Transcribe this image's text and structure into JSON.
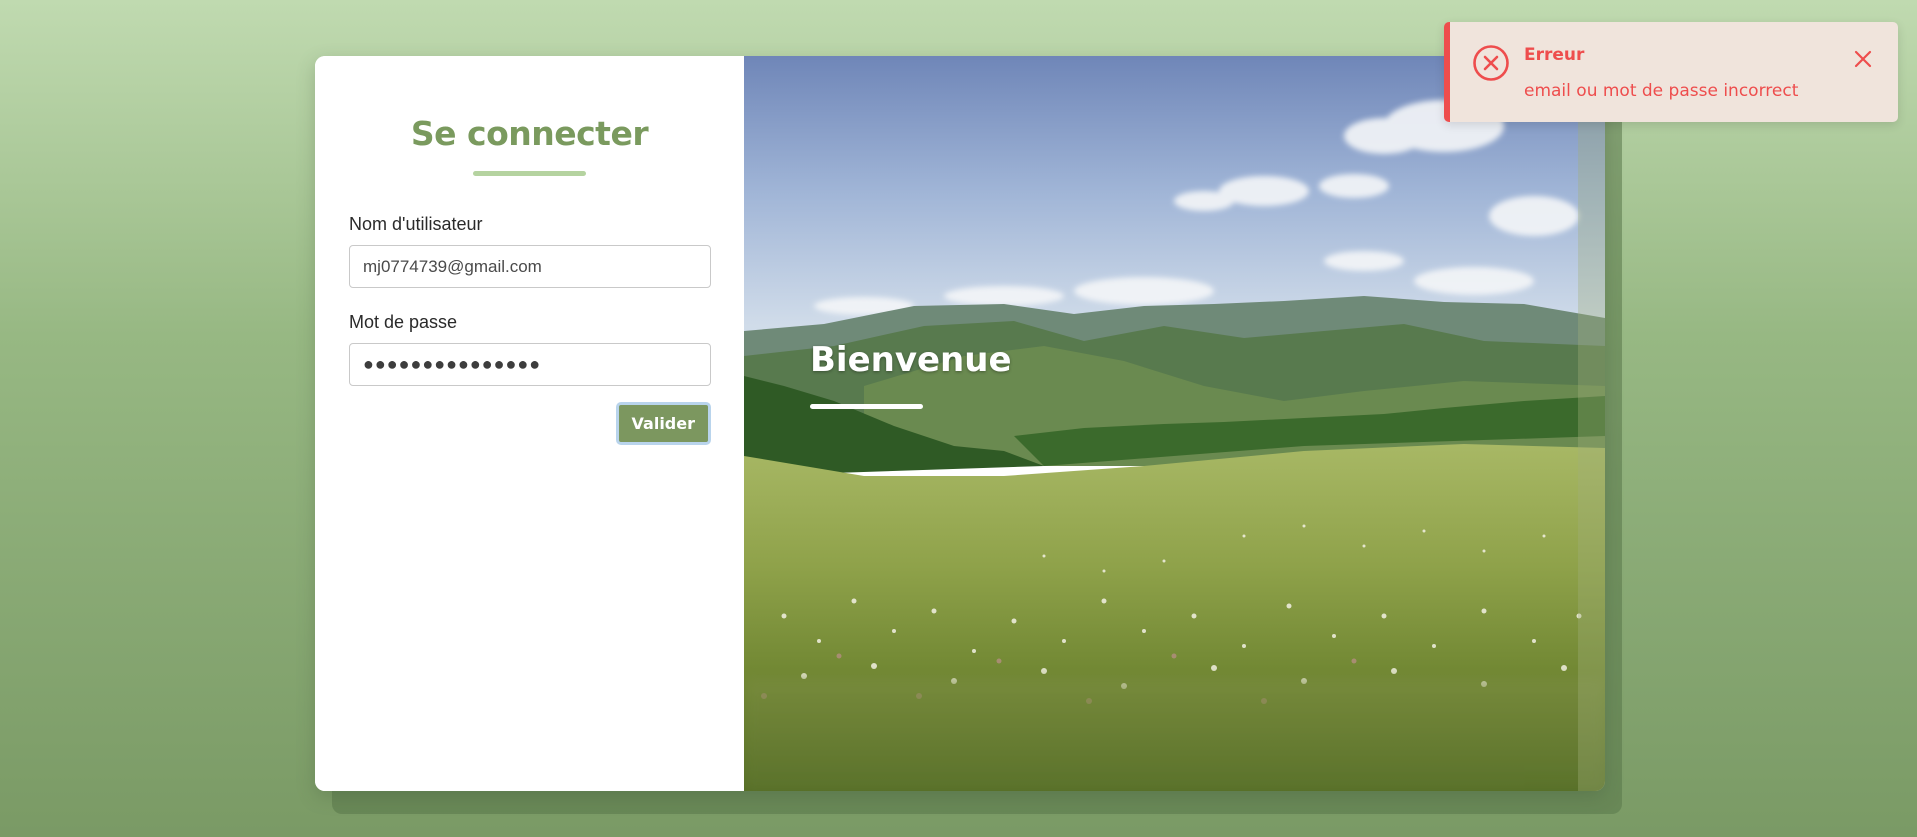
{
  "login": {
    "title": "Se connecter",
    "username_label": "Nom d'utilisateur",
    "username_value": "mj0774739@gmail.com",
    "password_label": "Mot de passe",
    "password_value": "●●●●●●●●●●●●●●●",
    "submit_label": "Valider"
  },
  "hero": {
    "welcome_text": "Bienvenue"
  },
  "toast": {
    "title": "Erreur",
    "message": "email ou mot de passe incorrect",
    "icon": "error-circle-x-icon",
    "close_icon": "close-icon"
  },
  "colors": {
    "accent": "#7c975f",
    "title": "#7a9a5e",
    "error": "#ee4d4d",
    "toast_bg": "#f0e4dc"
  }
}
